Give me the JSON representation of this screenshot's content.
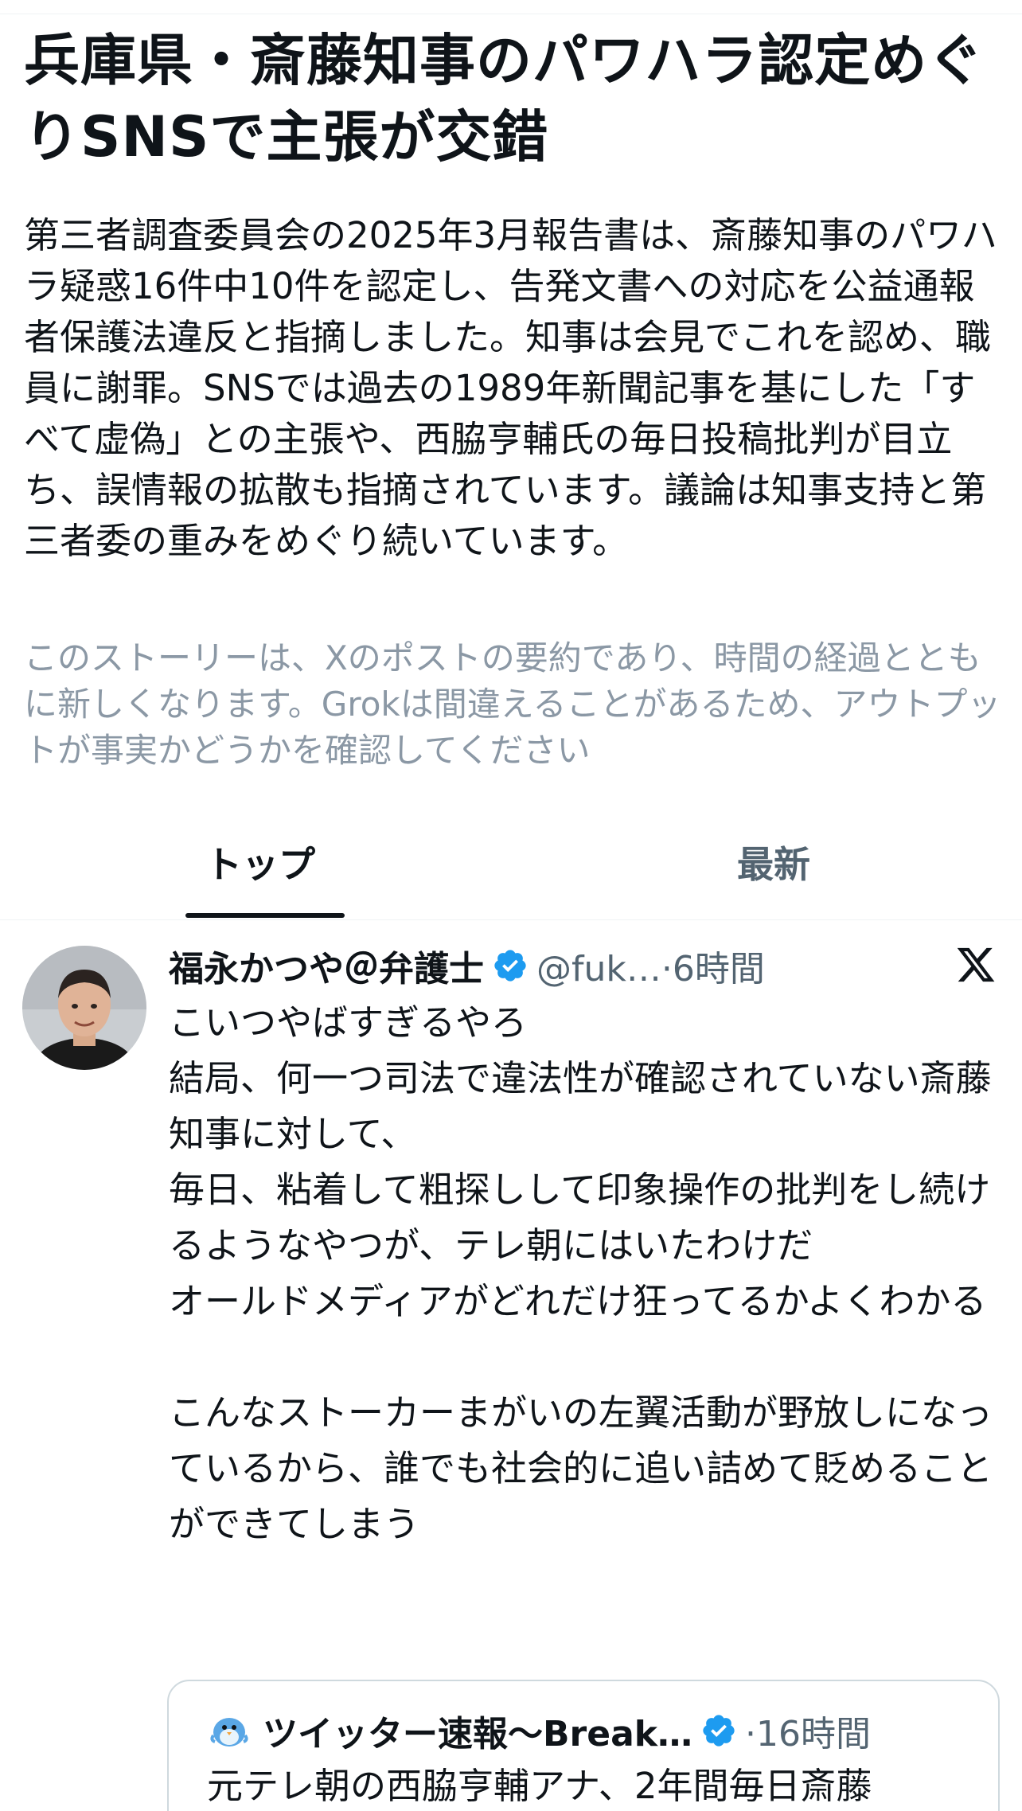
{
  "story": {
    "headline": "兵庫県・斎藤知事のパワハラ認定めぐりSNSで主張が交錯",
    "summary": "第三者調査委員会の2025年3月報告書は、斎藤知事のパワハラ疑惑16件中10件を認定し、告発文書への対応を公益通報者保護法違反と指摘しました。知事は会見でこれを認め、職員に謝罪。SNSでは過去の1989年新聞記事を基にした「すべて虚偽」との主張や、西脇亨輔氏の毎日投稿批判が目立ち、誤情報の拡散も指摘されています。議論は知事支持と第三者委の重みをめぐり続いています。",
    "disclaimer": "このストーリーは、Xのポストの要約であり、時間の経過とともに新しくなります。Grokは間違えることがあるため、アウトプットが事実かどうかを確認してください"
  },
  "tabs": [
    {
      "label": "トップ",
      "active": true
    },
    {
      "label": "最新",
      "active": false
    }
  ],
  "post": {
    "display_name": "福永かつや＠弁護士",
    "handle_time": "@fuk…·6時間",
    "text": "こいつやばすぎるやろ\n結局、何一つ司法で違法性が確認されていない斎藤知事に対して、\n毎日、粘着して粗探しして印象操作の批判をし続けるようなやつが、テレ朝にはいたわけだ\nオールドメディアがどれだけ狂ってるかよくわかる\n\nこんなストーカーまがいの左翼活動が野放しになっているから、誰でも社会的に追い詰めて貶めることができてしまう",
    "icons": {
      "verified": "verified-badge-icon",
      "platform": "x-logo-icon",
      "avatar": "avatar"
    },
    "quoted": {
      "name": "ツイッター速報〜Break…",
      "handle_time": "·16時間",
      "text": "元テレ朝の西脇亨輔アナ、2年間毎日斎藤"
    }
  },
  "colors": {
    "text": "#0f1419",
    "secondary": "#536471",
    "disclaimer": "#8b98a5",
    "verified": "#1d9bf0",
    "border": "#cfd9de"
  }
}
